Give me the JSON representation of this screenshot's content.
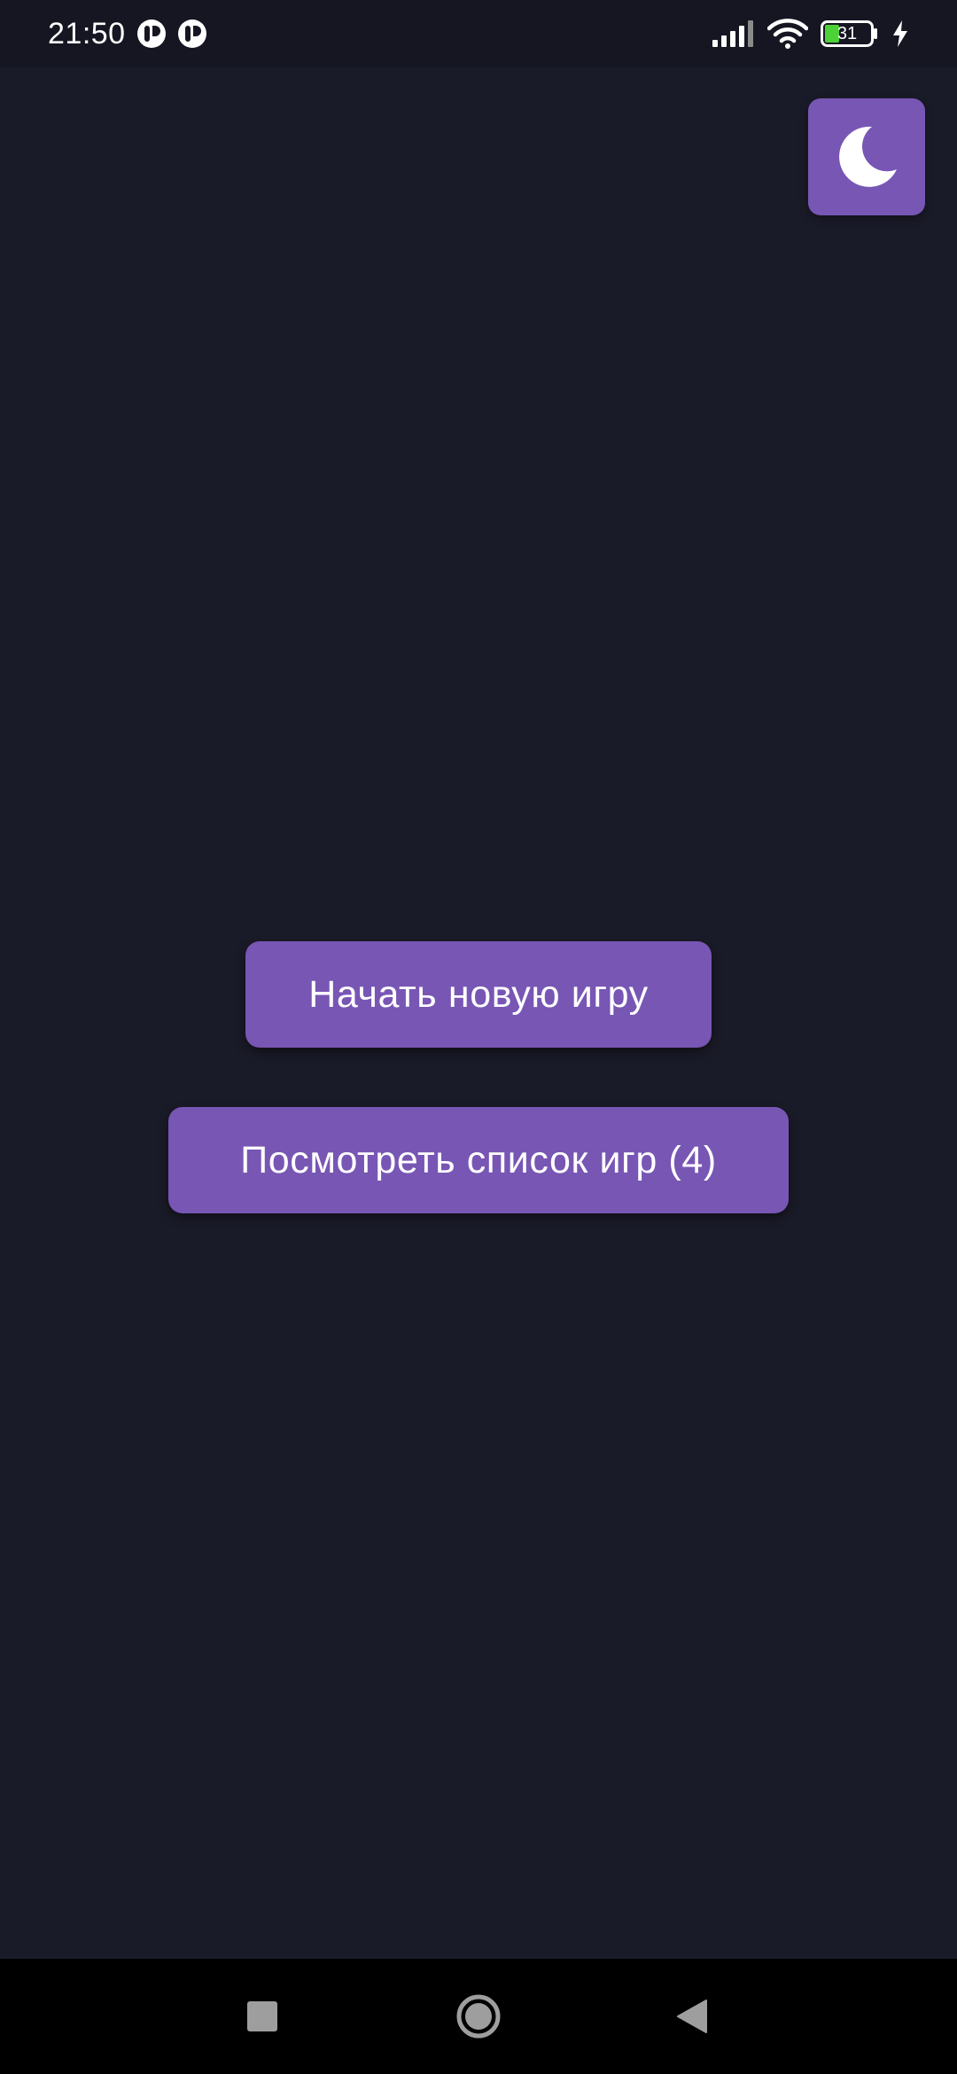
{
  "status_bar": {
    "time": "21:50",
    "battery_level": "31",
    "notification_icons": [
      "app-notification-icon",
      "app-notification-icon"
    ],
    "icons": [
      "signal-icon",
      "wifi-icon",
      "battery-icon",
      "charging-icon"
    ]
  },
  "theme_toggle": {
    "icon": "moon-icon"
  },
  "menu": {
    "new_game_label": "Начать новую игру",
    "game_list_label": "Посмотреть список игр (4)"
  },
  "navigation": {
    "icons": [
      "recent-apps-icon",
      "home-icon",
      "back-icon"
    ]
  },
  "colors": {
    "background": "#1a1b28",
    "accent": "#7856b4",
    "status_bar": "#151622",
    "nav_bar": "#000000",
    "text": "#ffffff"
  }
}
